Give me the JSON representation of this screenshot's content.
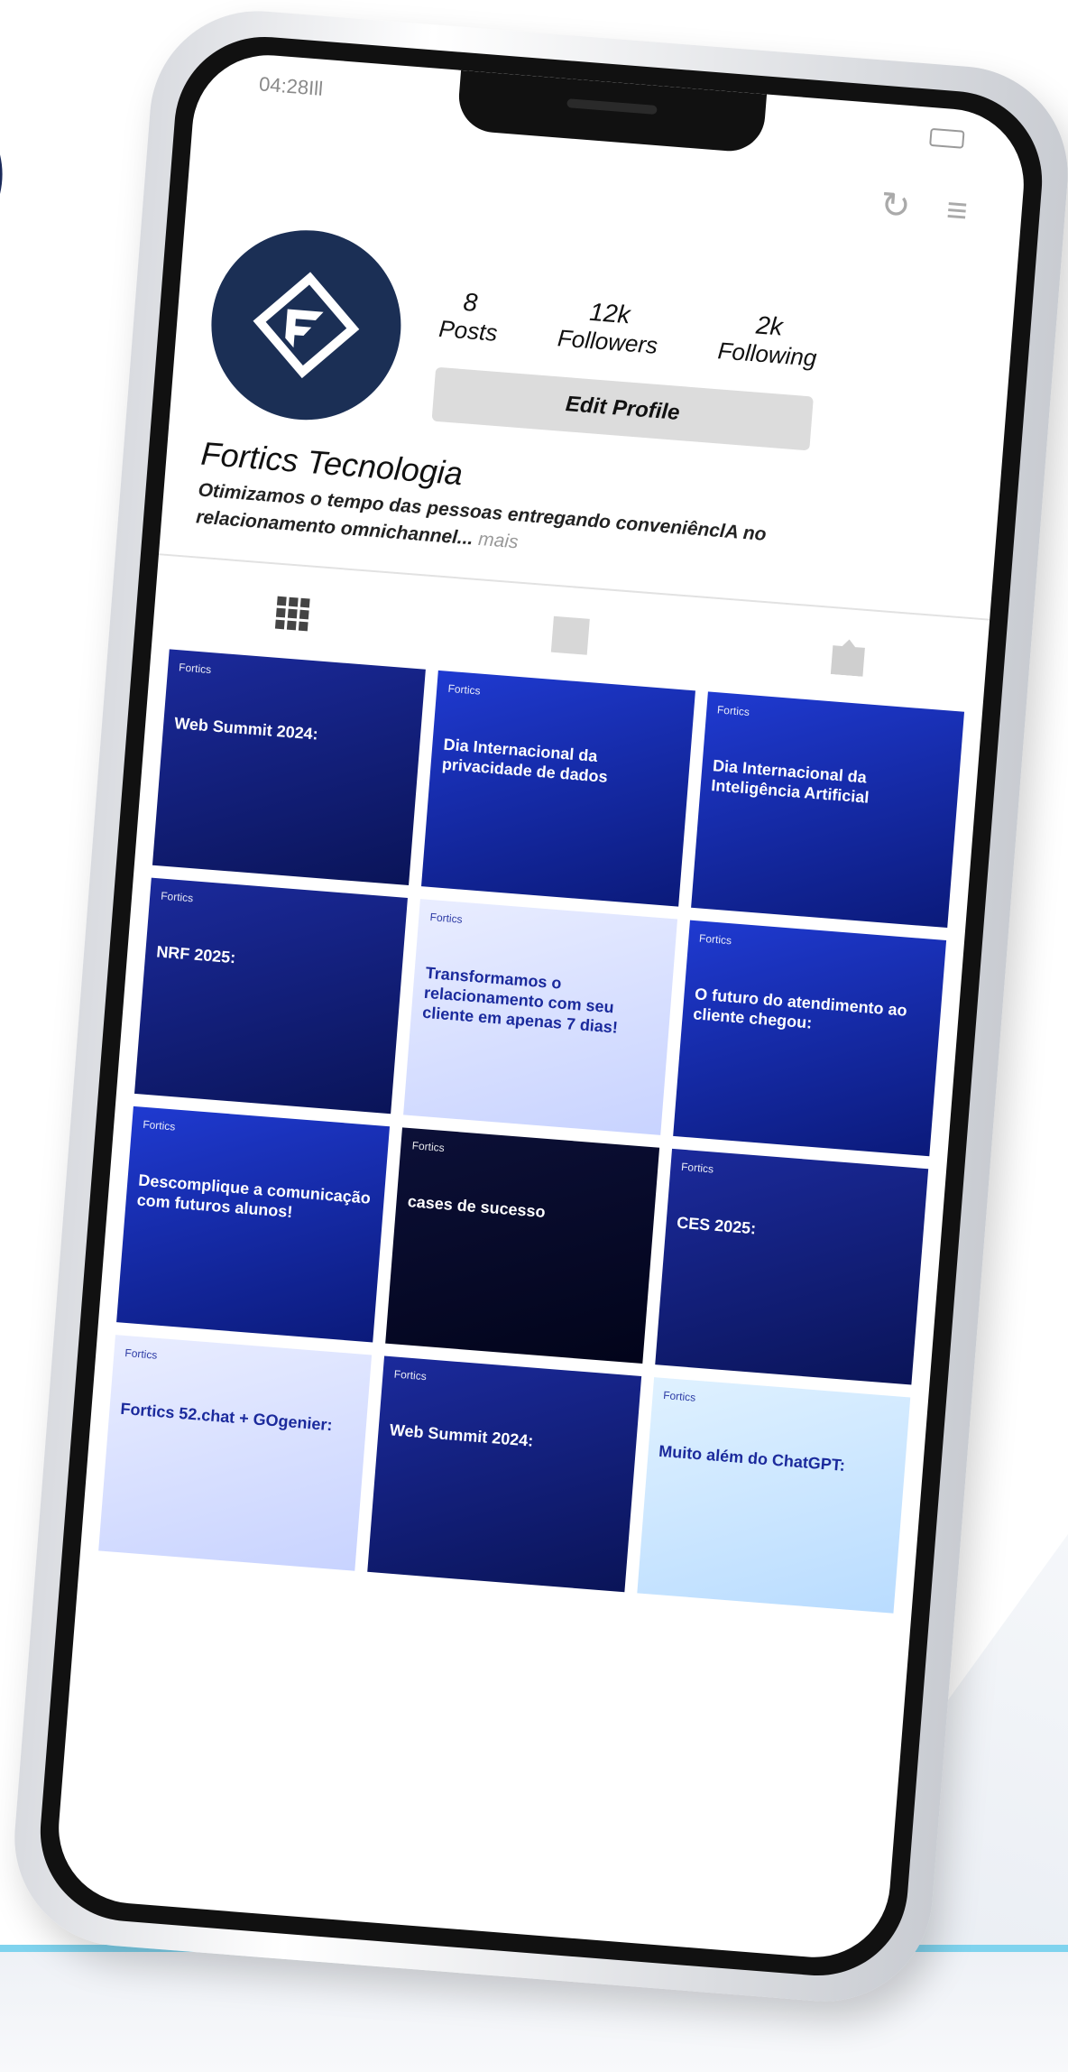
{
  "status_bar": {
    "time": "04:28",
    "signal": "Ill"
  },
  "profile": {
    "name": "Fortics Tecnologia",
    "bio": "Otimizamos o tempo das pessoas entregando conveniênclA no relacionamento omnichannel...",
    "bio_more": "mais",
    "stats": [
      {
        "value": "8",
        "label": "Posts"
      },
      {
        "value": "12k",
        "label": "Followers"
      },
      {
        "value": "2k",
        "label": "Following"
      }
    ],
    "edit_button": "Edit Profile"
  },
  "posts": [
    {
      "brand": "Fortics",
      "headline": "Web Summit 2024:",
      "style": "p-dark"
    },
    {
      "brand": "Fortics",
      "headline": "Dia Internacional da privacidade de dados",
      "style": "p-blue"
    },
    {
      "brand": "Fortics",
      "headline": "Dia Internacional da Inteligência Artificial",
      "style": "p-blue"
    },
    {
      "brand": "Fortics",
      "headline": "NRF 2025:",
      "style": "p-dark"
    },
    {
      "brand": "Fortics",
      "headline": "Transformamos o relacionamento com seu cliente em apenas 7 dias!",
      "style": "p-light"
    },
    {
      "brand": "Fortics",
      "headline": "O futuro do atendimento ao cliente chegou:",
      "style": "p-blue"
    },
    {
      "brand": "Fortics",
      "headline": "Descomplique a comunicação com futuros alunos!",
      "style": "p-blue"
    },
    {
      "brand": "Fortics",
      "headline": "cases de sucesso",
      "style": "p-black"
    },
    {
      "brand": "Fortics",
      "headline": "CES 2025:",
      "style": "p-dark"
    },
    {
      "brand": "Fortics",
      "headline": "Fortics 52.chat + GOgenier:",
      "style": "p-light"
    },
    {
      "brand": "Fortics",
      "headline": "Web Summit 2024:",
      "style": "p-dark"
    },
    {
      "brand": "Fortics",
      "headline": "Muito além do ChatGPT:",
      "style": "p-sky"
    }
  ],
  "colors": {
    "accent": "#1b2f55",
    "post_blue": "#1f3ad1",
    "stand_line": "#7fd3ee"
  },
  "icons": [
    "refresh-icon",
    "menu-icon",
    "grid-icon",
    "list-icon",
    "tag-icon"
  ]
}
